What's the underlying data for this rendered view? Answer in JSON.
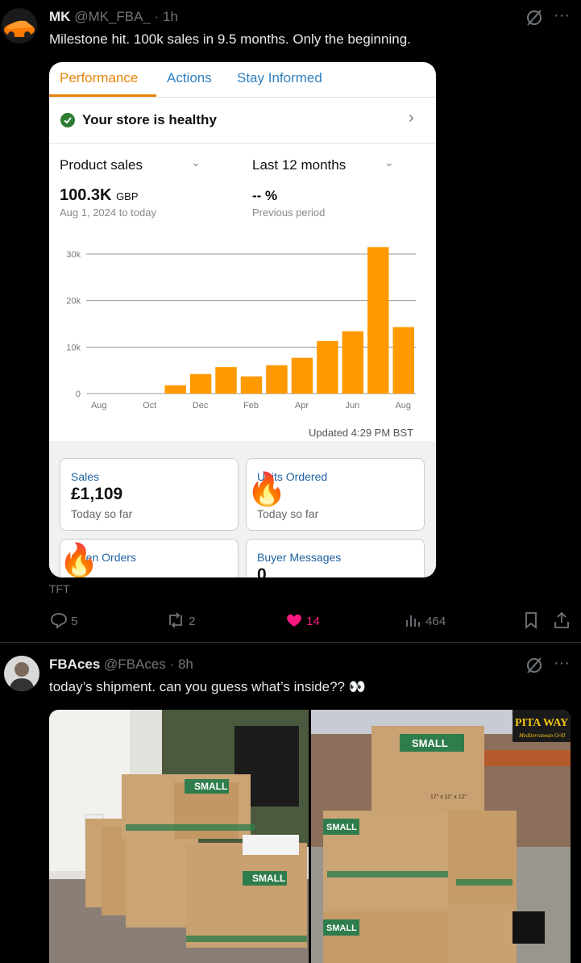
{
  "post1": {
    "name": "MK",
    "handle": "@MK_FBA_",
    "time": "· 1h",
    "text": "Milestone hit. 100k sales in 9.5 months. Only the beginning.",
    "caption": "TFT",
    "actions": {
      "replies": "5",
      "reposts": "2",
      "likes": "14",
      "views": "464"
    },
    "screenshot": {
      "tabs": [
        "Performance",
        "Actions",
        "Stay Informed"
      ],
      "health": "Your store is healthy",
      "metric_select": "Product sales",
      "period_select": "Last 12 months",
      "total": "100.3K",
      "currency": "GBP",
      "date_range": "Aug 1, 2024 to today",
      "change": "-- %",
      "change_label": "Previous period",
      "updated": "Updated 4:29 PM BST",
      "tiles": [
        {
          "label": "Sales",
          "value": "£1,109",
          "sub": "Today so far"
        },
        {
          "label": "Units Ordered",
          "value": "",
          "sub": "Today so far"
        },
        {
          "label": "Open Orders",
          "value": "",
          "sub": ""
        },
        {
          "label": "Buyer Messages",
          "value": "0",
          "sub": ""
        }
      ]
    }
  },
  "post2": {
    "name": "FBAces",
    "handle": "@FBAces",
    "time": "· 8h",
    "text": "today’s shipment. can you guess what’s inside?? 👀",
    "box_label": "SMALL",
    "box_size": "17\" x 11\" x 12\"",
    "sign": "PITA WAY",
    "sign_sub": "Mediterranean Grill"
  },
  "chart_data": {
    "type": "bar",
    "categories": [
      "Aug",
      "Sep",
      "Oct",
      "Nov",
      "Dec",
      "Jan",
      "Feb",
      "Mar",
      "Apr",
      "May",
      "Jun",
      "Jul",
      "Aug"
    ],
    "tick_labels": [
      "Aug",
      "Oct",
      "Dec",
      "Feb",
      "Apr",
      "Jun",
      "Aug"
    ],
    "values": [
      0,
      0,
      0,
      1800,
      4200,
      5700,
      3700,
      6100,
      7700,
      11300,
      13400,
      31500,
      14300
    ],
    "ylim": [
      0,
      30000
    ],
    "yticks": [
      "0",
      "10k",
      "20k",
      "30k"
    ],
    "bar_color": "#ff9900",
    "grid": true
  },
  "colors": {
    "accent": "#e8830c",
    "link": "#2f7fbf",
    "like": "#f91880"
  }
}
